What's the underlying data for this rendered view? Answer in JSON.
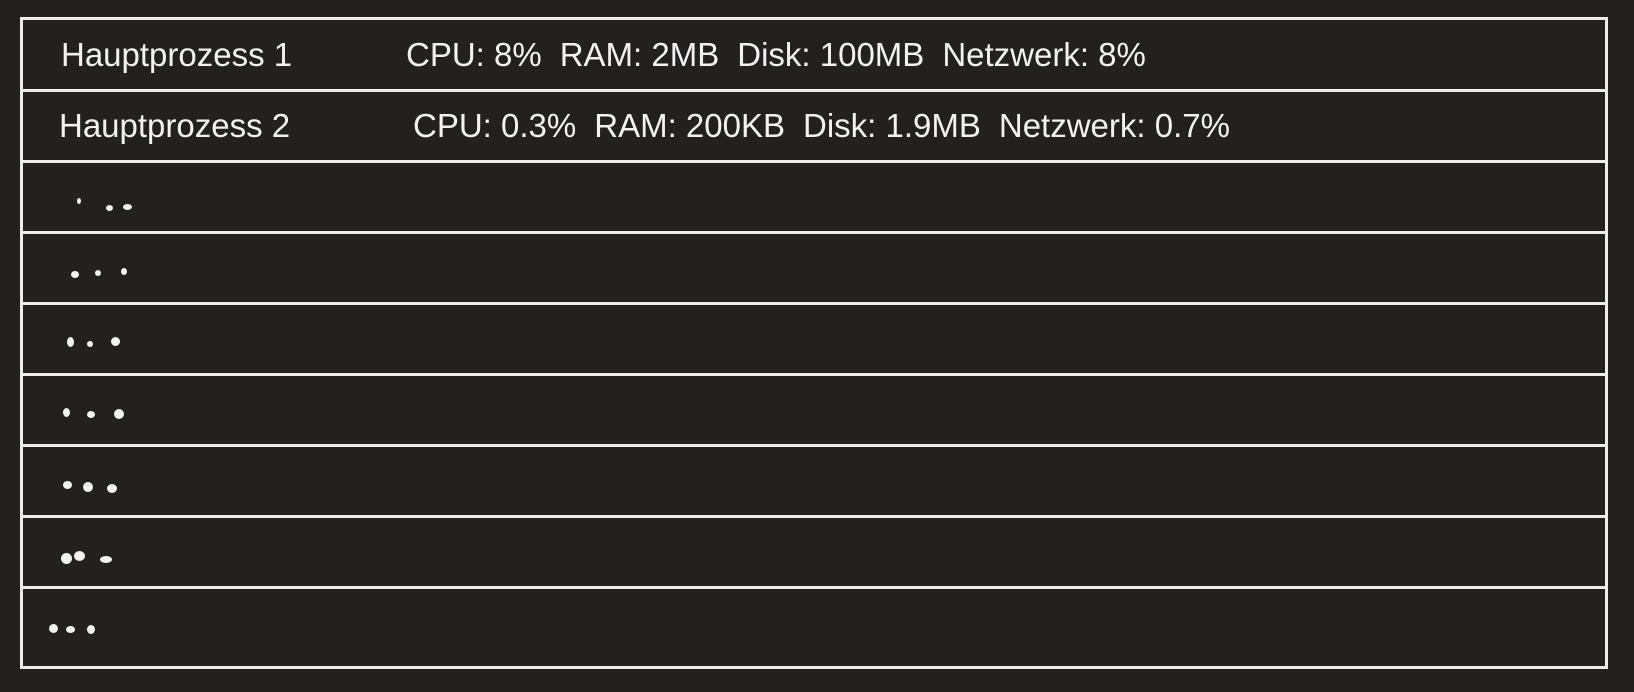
{
  "processes": [
    {
      "name": "Hauptprozess 1",
      "stats": {
        "cpu": "CPU: 8%",
        "ram": "RAM: 2MB",
        "disk": "Disk: 100MB",
        "network": "Netzwerk: 8%"
      }
    },
    {
      "name": "Hauptprozess 2",
      "stats": {
        "cpu": "CPU: 0.3%",
        "ram": "RAM: 200KB",
        "disk": "Disk: 1.9MB",
        "network": "Netzwerk: 0.7%"
      }
    }
  ],
  "placeholder_rows": 7
}
